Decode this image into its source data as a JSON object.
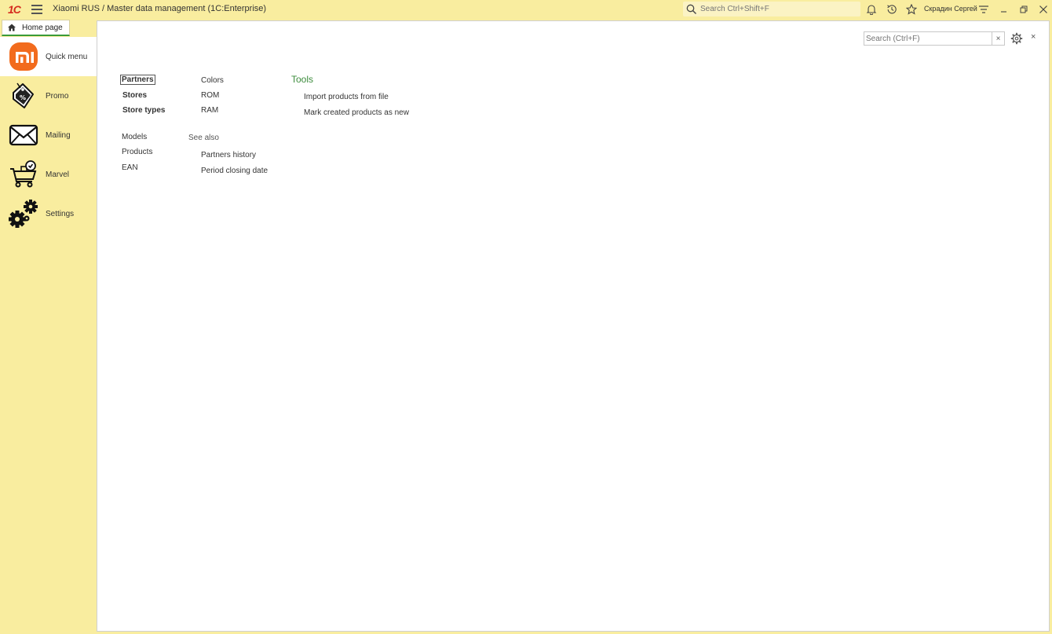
{
  "titlebar": {
    "logo_text": "1C",
    "title": "Xiaomi RUS / Master data management  (1C:Enterprise)",
    "search_placeholder": "Search Ctrl+Shift+F",
    "user_name": "Скрадин Сергей"
  },
  "tabs": {
    "home_label": "Home page"
  },
  "sidebar": {
    "items": [
      {
        "label": "Quick menu",
        "icon": "xiaomi-logo-icon"
      },
      {
        "label": "Promo",
        "icon": "price-tag-icon"
      },
      {
        "label": "Mailing",
        "icon": "envelope-icon"
      },
      {
        "label": "Marvel",
        "icon": "shopping-cart-icon"
      },
      {
        "label": "Settings",
        "icon": "gears-icon"
      }
    ]
  },
  "main": {
    "search_placeholder": "Search (Ctrl+F)",
    "clear_label": "×",
    "close_label": "×",
    "column1": [
      "Partners",
      "Stores",
      "Store types"
    ],
    "column1b": [
      "Models",
      "Products",
      "EAN"
    ],
    "column2": [
      "Colors",
      "ROM",
      "RAM"
    ],
    "see_also": {
      "caption": "See also",
      "items": [
        "Partners history",
        "Period closing date"
      ]
    },
    "tools": {
      "title": "Tools",
      "items": [
        "Import products from file",
        "Mark created products as new"
      ]
    }
  },
  "colors": {
    "accent_bg": "#f9ed9f",
    "group_title": "#3c8c3c",
    "xiaomi_orange": "#f26b1d"
  }
}
